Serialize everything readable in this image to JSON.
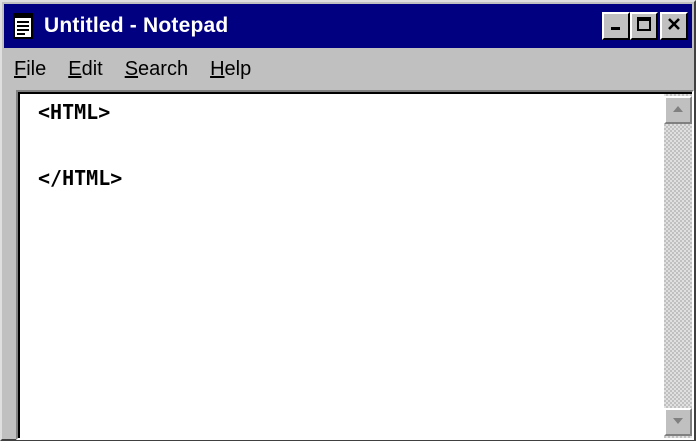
{
  "window": {
    "title": "Untitled - Notepad",
    "title_bar_color": "#000080",
    "app_icon": "notepad-icon",
    "buttons": {
      "minimize": "minimize-icon",
      "maximize": "maximize-icon",
      "close": "close-icon"
    }
  },
  "menu": {
    "items": [
      {
        "label": "File",
        "accelerator": "F",
        "rest": "ile"
      },
      {
        "label": "Edit",
        "accelerator": "E",
        "rest": "dit"
      },
      {
        "label": "Search",
        "accelerator": "S",
        "rest": "earch"
      },
      {
        "label": "Help",
        "accelerator": "H",
        "rest": "elp"
      }
    ]
  },
  "editor": {
    "content": "<HTML>\n\n</HTML>"
  },
  "scrollbar": {
    "up_icon": "scroll-up-arrow-icon",
    "down_icon": "scroll-down-arrow-icon"
  }
}
